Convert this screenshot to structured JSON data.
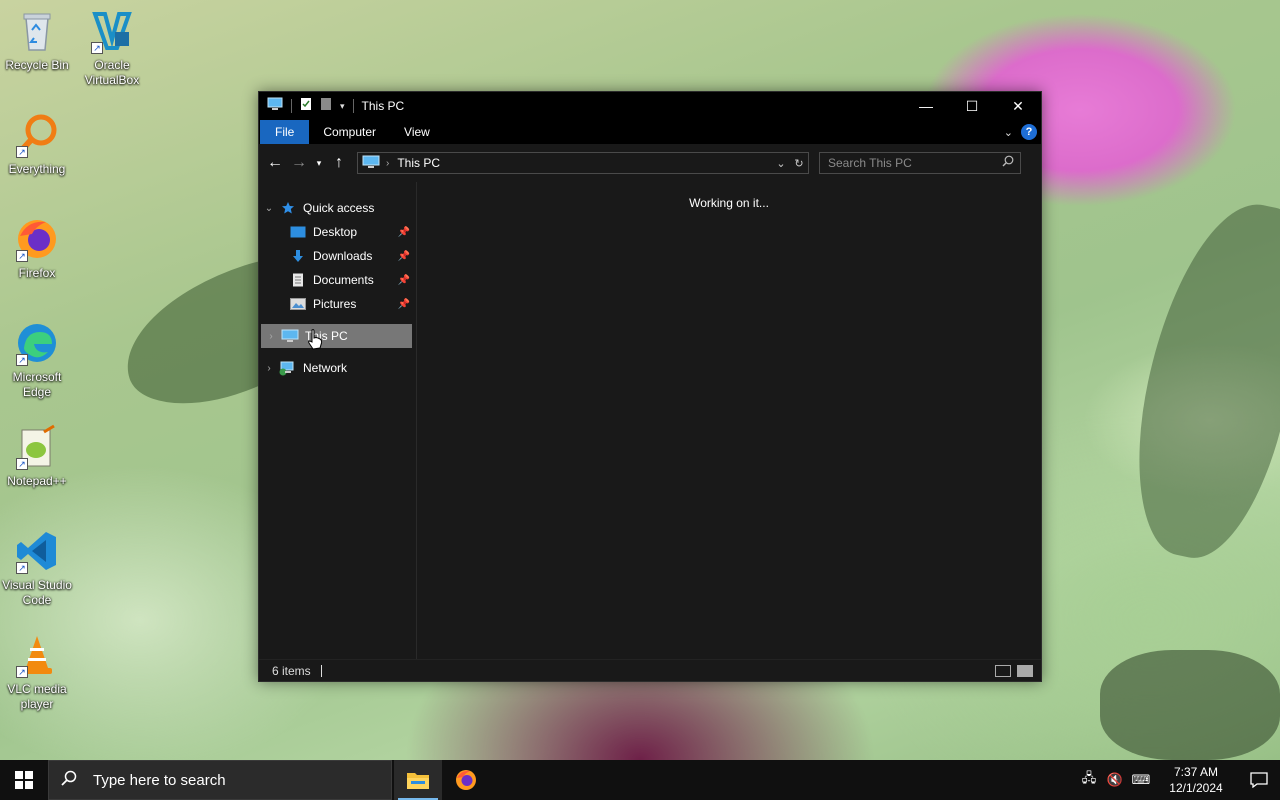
{
  "desktop": {
    "icons": [
      {
        "label": "Recycle Bin",
        "icon": "recycle-bin-icon"
      },
      {
        "label": "Oracle VirtualBox",
        "icon": "virtualbox-icon"
      },
      {
        "label": "Everything",
        "icon": "everything-search-icon"
      },
      {
        "label": "Firefox",
        "icon": "firefox-icon"
      },
      {
        "label": "Microsoft Edge",
        "icon": "edge-icon"
      },
      {
        "label": "Notepad++",
        "icon": "notepadpp-icon"
      },
      {
        "label": "Visual Studio Code",
        "icon": "vscode-icon"
      },
      {
        "label": "VLC media player",
        "icon": "vlc-icon"
      }
    ]
  },
  "window": {
    "title": "This PC",
    "controls": {
      "minimize": "—",
      "maximize": "☐",
      "close": "✕"
    },
    "ribbon": {
      "tabs": [
        "File",
        "Computer",
        "View"
      ],
      "help": "?"
    },
    "address": {
      "location": "This PC"
    },
    "search": {
      "placeholder": "Search This PC"
    },
    "nav": {
      "quick_access": "Quick access",
      "items": [
        {
          "label": "Desktop",
          "pinned": true
        },
        {
          "label": "Downloads",
          "pinned": true
        },
        {
          "label": "Documents",
          "pinned": true
        },
        {
          "label": "Pictures",
          "pinned": true
        }
      ],
      "this_pc": "This PC",
      "network": "Network"
    },
    "content": {
      "status_message": "Working on it..."
    },
    "statusbar": {
      "item_count": "6 items"
    }
  },
  "taskbar": {
    "search_placeholder": "Type here to search",
    "clock": {
      "time": "7:37 AM",
      "date": "12/1/2024"
    }
  },
  "colors": {
    "accent": "#1967c0",
    "window_bg": "#191919",
    "selection": "#777777",
    "taskbar": "#101010"
  }
}
